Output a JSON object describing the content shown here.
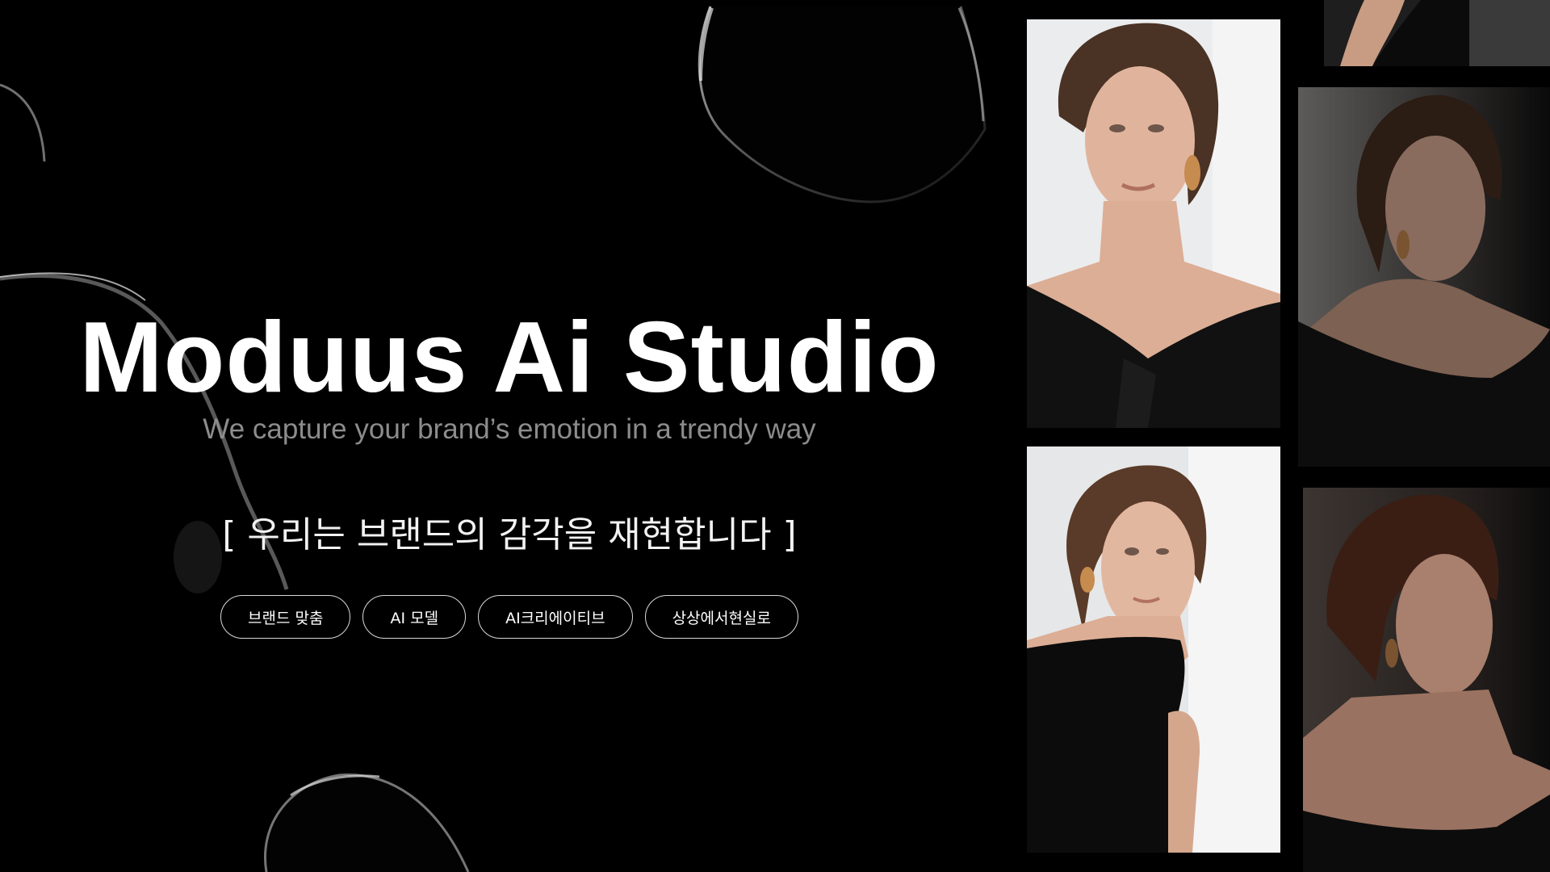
{
  "hero": {
    "title": "Moduus Ai Studio",
    "tagline": "We capture your brand’s emotion in a trendy way",
    "korean_heading": "[ 우리는 브랜드의 감각을 재현합니다 ]"
  },
  "tags": [
    {
      "label": "브랜드 맞춤"
    },
    {
      "label": "AI 모델"
    },
    {
      "label": "AI크리에이티브"
    },
    {
      "label": "상상에서현실로"
    }
  ],
  "gallery": {
    "photos": [
      {
        "subject": "model-portrait-front",
        "background": "#e9eaeb"
      },
      {
        "subject": "model-portrait-over-shoulder",
        "background": "#e6e7e8"
      },
      {
        "subject": "model-portrait-dim-side",
        "background": "#3a3836"
      },
      {
        "subject": "model-portrait-dim-profile",
        "background": "#2a2624"
      },
      {
        "subject": "model-arm-crop",
        "background": "#2c2c2c"
      }
    ]
  },
  "colors": {
    "background": "#000000",
    "title": "#ffffff",
    "tagline": "#8c8c8c",
    "pill_border": "#d9d9d9"
  }
}
